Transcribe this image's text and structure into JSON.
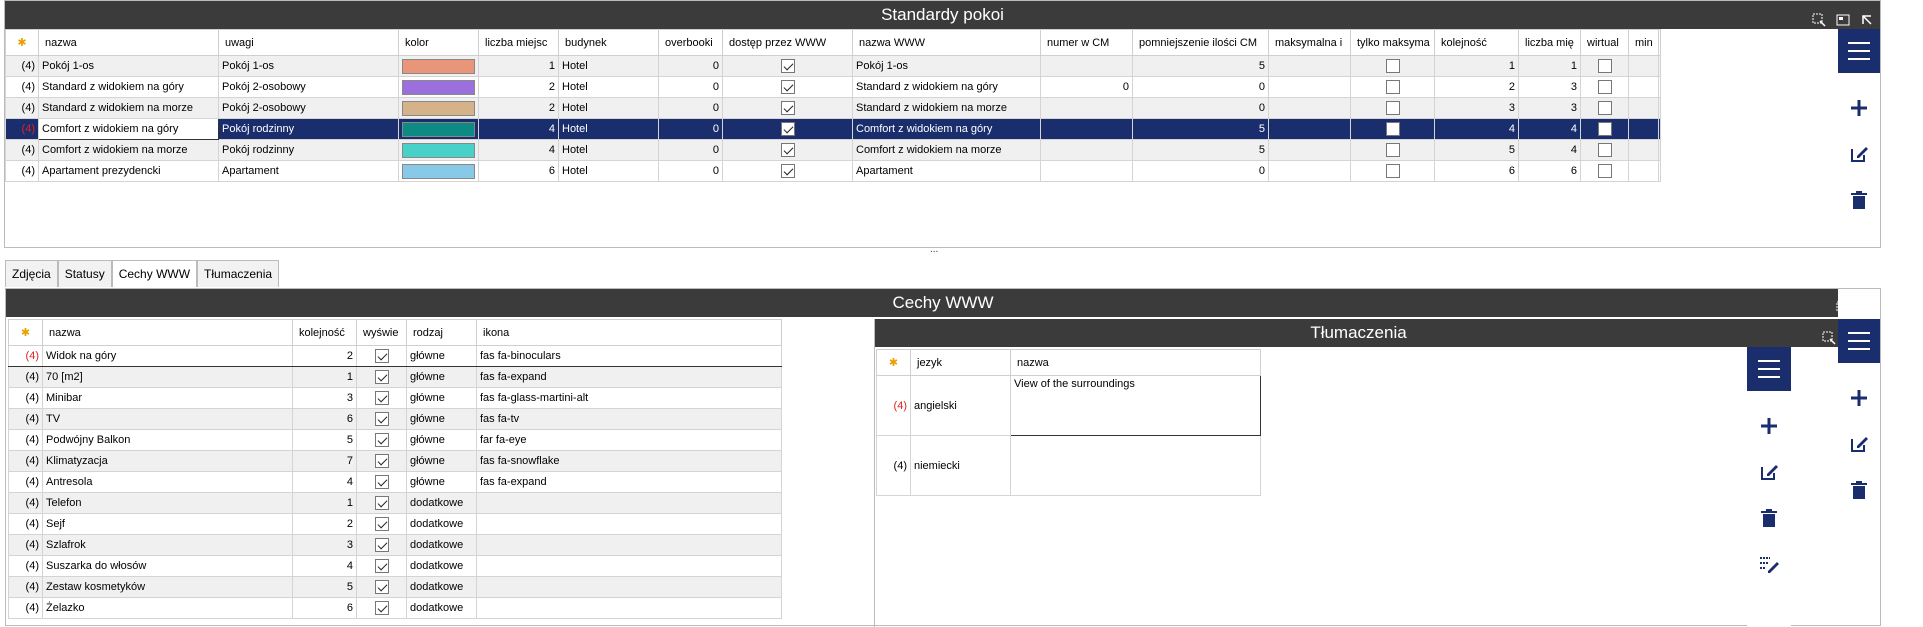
{
  "top": {
    "title": "Standardy pokoi",
    "columns": [
      "nazwa",
      "uwagi",
      "kolor",
      "liczba miejsc",
      "budynek",
      "overbooki",
      "dostęp przez WWW",
      "nazwa WWW",
      "numer w CM",
      "pomniejszenie ilości CM",
      "maksymalna i",
      "tylko maksyma",
      "kolejność",
      "liczba mię",
      "wirtual",
      "min"
    ],
    "rows": [
      {
        "st": "(4)",
        "nazwa": "Pokój 1-os",
        "uwagi": "Pokój 1-os",
        "kolor": "#e8957a",
        "miejsc": "1",
        "budynek": "Hotel",
        "overb": "0",
        "www": true,
        "nazwa_www": "Pokój 1-os",
        "cm": "",
        "pomn": "5",
        "maks": "",
        "tylko": false,
        "kol": "1",
        "lm": "1",
        "wirt": false
      },
      {
        "st": "(4)",
        "nazwa": "Standard z widokiem na góry",
        "uwagi": "Pokój 2-osobowy",
        "kolor": "#9b6fdc",
        "miejsc": "2",
        "budynek": "Hotel",
        "overb": "0",
        "www": true,
        "nazwa_www": "Standard z widokiem na góry",
        "cm": "0",
        "pomn": "0",
        "maks": "",
        "tylko": false,
        "kol": "2",
        "lm": "3",
        "wirt": false
      },
      {
        "st": "(4)",
        "nazwa": "Standard z widokiem na morze",
        "uwagi": "Pokój 2-osobowy",
        "kolor": "#d6b28a",
        "miejsc": "2",
        "budynek": "Hotel",
        "overb": "0",
        "www": true,
        "nazwa_www": "Standard z widokiem na morze",
        "cm": "",
        "pomn": "0",
        "maks": "",
        "tylko": false,
        "kol": "3",
        "lm": "3",
        "wirt": false
      },
      {
        "st": "(4)",
        "nazwa": "Comfort z widokiem na góry",
        "uwagi": "Pokój rodzinny",
        "kolor": "#0e8a85",
        "miejsc": "4",
        "budynek": "Hotel",
        "overb": "0",
        "www": true,
        "nazwa_www": "Comfort z widokiem na góry",
        "cm": "",
        "pomn": "5",
        "maks": "",
        "tylko": false,
        "kol": "4",
        "lm": "4",
        "wirt": false
      },
      {
        "st": "(4)",
        "nazwa": "Comfort z widokiem na morze",
        "uwagi": "Pokój rodzinny",
        "kolor": "#48d1c8",
        "miejsc": "4",
        "budynek": "Hotel",
        "overb": "0",
        "www": true,
        "nazwa_www": "Comfort z widokiem na morze",
        "cm": "",
        "pomn": "5",
        "maks": "",
        "tylko": false,
        "kol": "5",
        "lm": "4",
        "wirt": false
      },
      {
        "st": "(4)",
        "nazwa": "Apartament prezydencki",
        "uwagi": "Apartament",
        "kolor": "#87c9e6",
        "miejsc": "6",
        "budynek": "Hotel",
        "overb": "0",
        "www": true,
        "nazwa_www": "Apartament",
        "cm": "",
        "pomn": "0",
        "maks": "",
        "tylko": false,
        "kol": "6",
        "lm": "6",
        "wirt": false
      }
    ]
  },
  "tabs": [
    "Zdjęcia",
    "Statusy",
    "Cechy WWW",
    "Tłumaczenia"
  ],
  "cechy": {
    "title": "Cechy WWW",
    "columns": [
      "nazwa",
      "kolejność",
      "wyświe",
      "rodzaj",
      "ikona"
    ],
    "rows": [
      {
        "st": "(4)",
        "nazwa": "Widok na góry",
        "kol": "2",
        "w": true,
        "rodzaj": "główne",
        "ikona": "fas fa-binoculars"
      },
      {
        "st": "(4)",
        "nazwa": "70 [m2]",
        "kol": "1",
        "w": true,
        "rodzaj": "główne",
        "ikona": "fas fa-expand"
      },
      {
        "st": "(4)",
        "nazwa": "Minibar",
        "kol": "3",
        "w": true,
        "rodzaj": "główne",
        "ikona": "fas fa-glass-martini-alt"
      },
      {
        "st": "(4)",
        "nazwa": "TV",
        "kol": "6",
        "w": true,
        "rodzaj": "główne",
        "ikona": "fas fa-tv"
      },
      {
        "st": "(4)",
        "nazwa": "Podwójny Balkon",
        "kol": "5",
        "w": true,
        "rodzaj": "główne",
        "ikona": "far fa-eye"
      },
      {
        "st": "(4)",
        "nazwa": "Klimatyzacja",
        "kol": "7",
        "w": true,
        "rodzaj": "główne",
        "ikona": "fas fa-snowflake"
      },
      {
        "st": "(4)",
        "nazwa": "Antresola",
        "kol": "4",
        "w": true,
        "rodzaj": "główne",
        "ikona": "fas fa-expand"
      },
      {
        "st": "(4)",
        "nazwa": "Telefon",
        "kol": "1",
        "w": true,
        "rodzaj": "dodatkowe",
        "ikona": ""
      },
      {
        "st": "(4)",
        "nazwa": "Sejf",
        "kol": "2",
        "w": true,
        "rodzaj": "dodatkowe",
        "ikona": ""
      },
      {
        "st": "(4)",
        "nazwa": "Szlafrok",
        "kol": "3",
        "w": true,
        "rodzaj": "dodatkowe",
        "ikona": ""
      },
      {
        "st": "(4)",
        "nazwa": "Suszarka do włosów",
        "kol": "4",
        "w": true,
        "rodzaj": "dodatkowe",
        "ikona": ""
      },
      {
        "st": "(4)",
        "nazwa": "Zestaw kosmetyków",
        "kol": "5",
        "w": true,
        "rodzaj": "dodatkowe",
        "ikona": ""
      },
      {
        "st": "(4)",
        "nazwa": "Żelazko",
        "kol": "6",
        "w": true,
        "rodzaj": "dodatkowe",
        "ikona": ""
      }
    ]
  },
  "tlum": {
    "title": "Tłumaczenia",
    "columns": [
      "jezyk",
      "nazwa"
    ],
    "rows": [
      {
        "st": "(4)",
        "jezyk": "angielski",
        "nazwa": "View of the surroundings"
      },
      {
        "st": "(4)",
        "jezyk": "niemiecki",
        "nazwa": ""
      }
    ]
  },
  "resize_handle": "...",
  "colors": {
    "header": "#3b3b3b",
    "accent": "#1a2e6e",
    "status_red": "#e02020"
  }
}
